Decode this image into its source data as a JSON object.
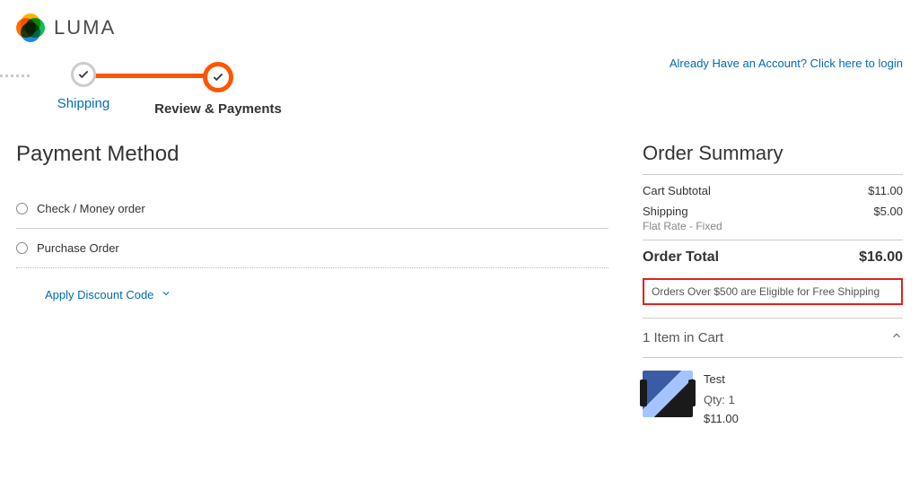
{
  "logo_text": "LUMA",
  "login_link": "Already Have an Account? Click here to login",
  "steps": {
    "shipping": "Shipping",
    "review": "Review & Payments"
  },
  "page_title": "Payment Method",
  "payment_methods": {
    "check": "Check / Money order",
    "po": "Purchase Order"
  },
  "discount_label": "Apply Discount Code",
  "summary": {
    "title": "Order Summary",
    "subtotal_label": "Cart Subtotal",
    "subtotal_value": "$11.00",
    "shipping_label": "Shipping",
    "shipping_value": "$5.00",
    "shipping_method": "Flat Rate - Fixed",
    "total_label": "Order Total",
    "total_value": "$16.00",
    "promo": "Orders Over $500 are Eligible for Free Shipping",
    "cart_header": "1 Item in Cart",
    "item": {
      "name": "Test",
      "qty": "Qty: 1",
      "price": "$11.00"
    }
  }
}
